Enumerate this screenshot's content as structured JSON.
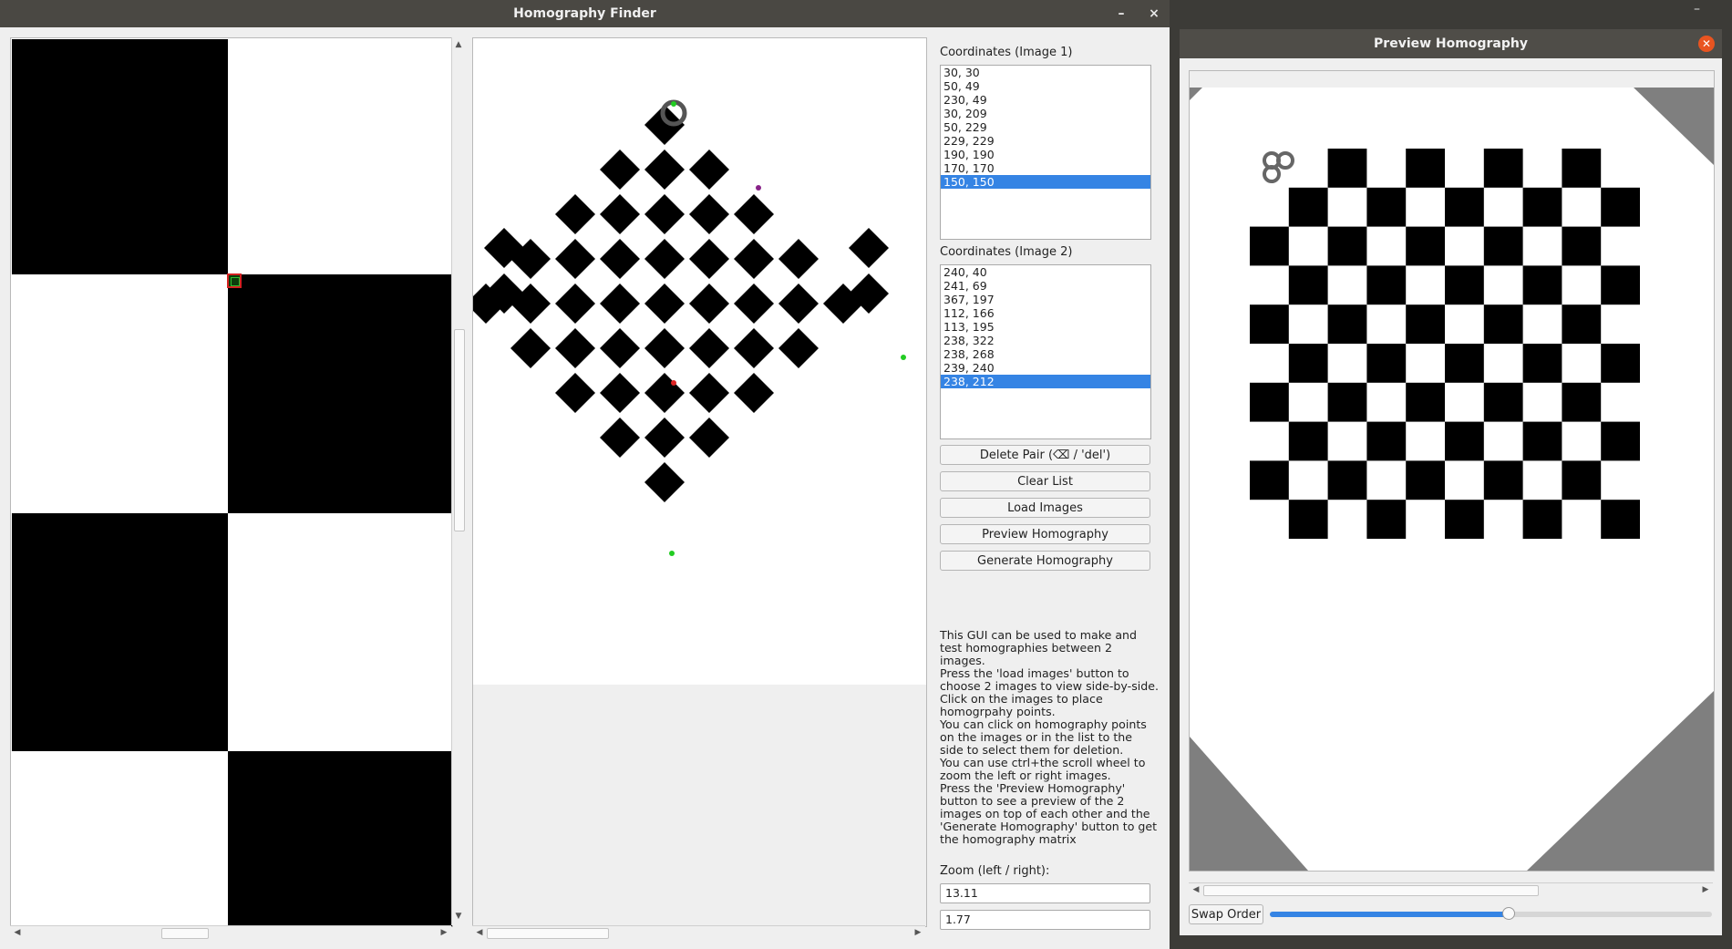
{
  "main_window": {
    "title": "Homography Finder",
    "minimize_glyph": "–",
    "close_glyph": "×"
  },
  "top_right_minimize_glyph": "–",
  "coords1": {
    "label": "Coordinates (Image 1)",
    "items": [
      "30, 30",
      "50, 49",
      "230, 49",
      "30, 209",
      "50, 229",
      "229, 229",
      "190, 190",
      "170, 170",
      "150, 150"
    ],
    "selected_index": 8
  },
  "coords2": {
    "label": "Coordinates (Image 2)",
    "items": [
      "240, 40",
      "241, 69",
      "367, 197",
      "112, 166",
      "113, 195",
      "238, 322",
      "238, 268",
      "239, 240",
      "238, 212"
    ],
    "selected_index": 8
  },
  "buttons": {
    "delete_pair": "Delete Pair (⌫ / 'del')",
    "clear_list": "Clear List",
    "load_images": "Load Images",
    "preview_homography": "Preview Homography",
    "generate_homography": "Generate Homography"
  },
  "help_text_1": "This GUI can be used to make and test homographies between 2 images.\nPress the 'load images' button to choose 2 images to view side-by-side.\nClick on the images to place homogrpahy points.\nYou can click on homography points on the images or in the list to the side to select them for deletion.\nYou can use ctrl+the scroll wheel to zoom the left or right images.",
  "help_text_2": "Press the 'Preview Homography' button to see a preview of the 2 images on top of each other and the 'Generate Homography' button to get the homography matrix",
  "zoom": {
    "label": "Zoom (left / right):",
    "left_value": "13.11",
    "right_value": "1.77"
  },
  "preview_window": {
    "title": "Preview Homography",
    "swap_label": "Swap Order",
    "slider_value": 0.54
  },
  "colors": {
    "selection": "#3584e4",
    "close_button": "#e95420",
    "point_green": "#22cc22",
    "point_red": "#dd2222",
    "point_purple": "#882288"
  }
}
